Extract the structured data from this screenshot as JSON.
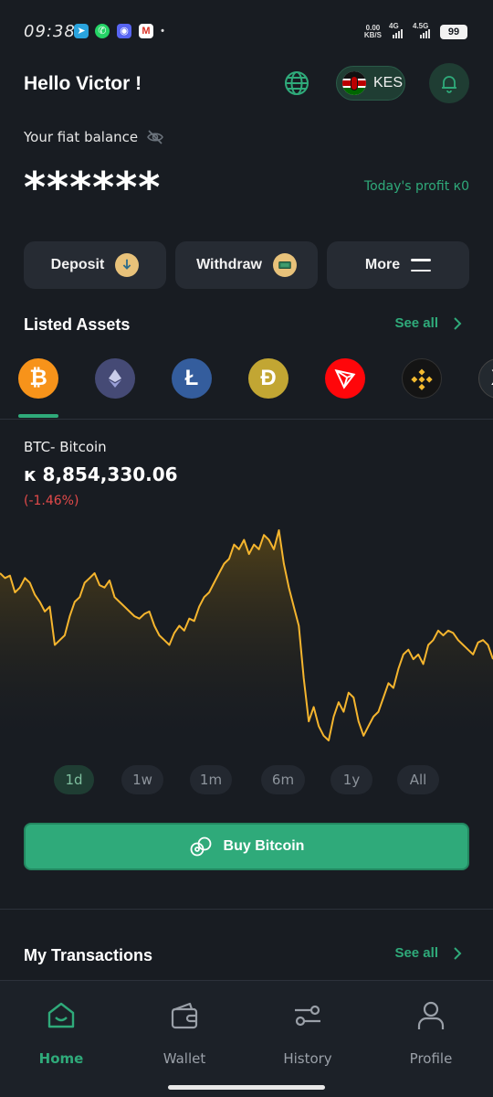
{
  "status_bar": {
    "time": "09:38",
    "net_speed_top": "0.00",
    "net_speed_bottom": "KB/S",
    "signal1_label": "4G",
    "signal2_label": "4.5G",
    "battery": "99"
  },
  "header": {
    "greeting": "Hello Victor !",
    "currency": "KES",
    "globe_icon": "globe-icon",
    "bell_icon": "bell-icon"
  },
  "balance": {
    "label": "Your fiat balance",
    "masked_value": "******",
    "profit": "Today's profit к0"
  },
  "actions": {
    "deposit": "Deposit",
    "withdraw": "Withdraw",
    "more": "More"
  },
  "assets": {
    "title": "Listed Assets",
    "see_all": "See all",
    "items": [
      {
        "name": "Bitcoin",
        "symbol": "B",
        "color": "#f7931a"
      },
      {
        "name": "Ethereum",
        "symbol": "◆",
        "color": "#454a75"
      },
      {
        "name": "Litecoin",
        "symbol": "Ł",
        "color": "#345d9d"
      },
      {
        "name": "Dogecoin",
        "symbol": "Ð",
        "color": "#c2a633"
      },
      {
        "name": "Tron",
        "symbol": "▽",
        "color": "#ff060a"
      },
      {
        "name": "BNB",
        "symbol": "◇",
        "color": "#1a1a1a"
      },
      {
        "name": "XRP",
        "symbol": "X",
        "color": "#23292f"
      }
    ]
  },
  "selected_coin": {
    "name": "BTC- Bitcoin",
    "price": "к 8,854,330.06",
    "change": "(-1.46%)"
  },
  "chart_data": {
    "type": "area",
    "title": "",
    "xlabel": "",
    "ylabel": "",
    "line_color": "#f5b52e",
    "values": [
      74,
      72,
      73,
      66,
      68,
      72,
      70,
      65,
      62,
      58,
      60,
      44,
      46,
      48,
      56,
      62,
      64,
      70,
      72,
      74,
      69,
      68,
      71,
      64,
      62,
      60,
      58,
      56,
      55,
      57,
      58,
      52,
      48,
      46,
      44,
      49,
      52,
      50,
      55,
      54,
      60,
      64,
      66,
      70,
      74,
      78,
      80,
      86,
      84,
      88,
      82,
      86,
      84,
      90,
      88,
      84,
      92,
      78,
      68,
      60,
      52,
      30,
      12,
      18,
      10,
      6,
      4,
      14,
      20,
      16,
      24,
      22,
      12,
      6,
      10,
      14,
      16,
      22,
      28,
      26,
      34,
      40,
      42,
      38,
      40,
      36,
      44,
      46,
      50,
      48,
      50,
      49,
      46,
      44,
      42,
      40,
      45,
      46,
      44,
      38
    ]
  },
  "ranges": {
    "items": [
      "1d",
      "1w",
      "1m",
      "6m",
      "1y",
      "All"
    ],
    "active": "1d"
  },
  "buy_button": "Buy Bitcoin",
  "transactions": {
    "title": "My Transactions",
    "see_all": "See all"
  },
  "nav": {
    "home": "Home",
    "wallet": "Wallet",
    "history": "History",
    "profile": "Profile"
  },
  "colors": {
    "background": "#181c22",
    "accent": "#2faa7a",
    "card": "#262b33",
    "negative": "#e24a4a"
  }
}
